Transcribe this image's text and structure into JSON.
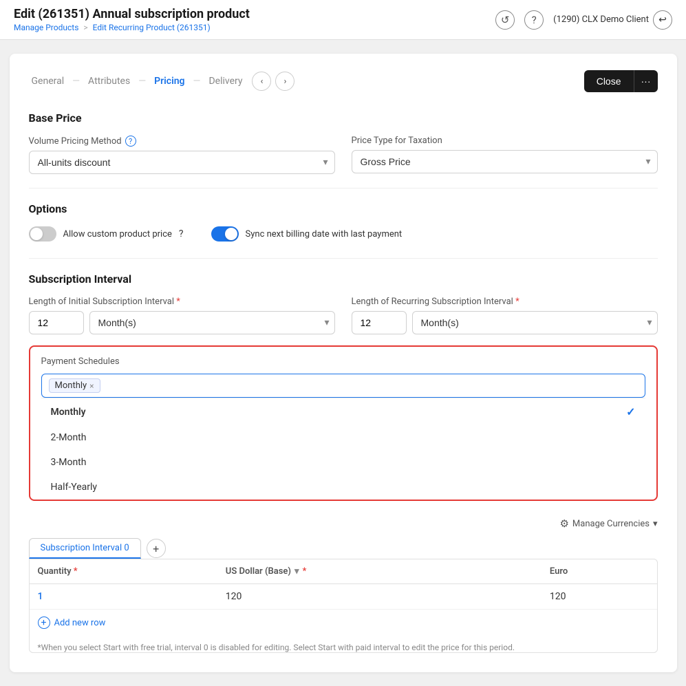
{
  "page": {
    "title": "Edit (261351) Annual subscription product",
    "breadcrumb_root": "Manage Products",
    "breadcrumb_sep": ">",
    "breadcrumb_current": "Edit Recurring Product (261351)"
  },
  "topbar": {
    "history_icon": "↺",
    "help_icon": "?",
    "client_label": "(1290) CLX Demo Client",
    "client_icon": "↩"
  },
  "nav": {
    "tabs": [
      {
        "label": "General",
        "active": false
      },
      {
        "label": "Attributes",
        "active": false
      },
      {
        "label": "Pricing",
        "active": true
      },
      {
        "label": "Delivery",
        "active": false
      }
    ],
    "close_label": "Close",
    "more_label": "···"
  },
  "base_price": {
    "section_title": "Base Price",
    "volume_label": "Volume Pricing Method",
    "volume_help": "?",
    "volume_value": "All-units discount",
    "price_type_label": "Price Type for Taxation",
    "price_type_value": "Gross Price"
  },
  "options": {
    "section_title": "Options",
    "allow_custom_label": "Allow custom product price",
    "allow_custom_toggle": "off",
    "sync_label": "Sync next billing date with last payment",
    "sync_toggle": "on"
  },
  "subscription_interval": {
    "section_title": "Subscription Interval",
    "initial_label": "Length of Initial Subscription Interval",
    "initial_value": "12",
    "initial_unit": "Month(s)",
    "recurring_label": "Length of Recurring Subscription Interval",
    "recurring_value": "12",
    "recurring_unit": "Month(s)"
  },
  "payment_schedules": {
    "label": "Payment Schedules",
    "selected_tag": "Monthly",
    "input_placeholder": "",
    "dropdown_items": [
      {
        "label": "Monthly",
        "selected": true
      },
      {
        "label": "2-Month",
        "selected": false
      },
      {
        "label": "3-Month",
        "selected": false
      },
      {
        "label": "Half-Yearly",
        "selected": false
      }
    ]
  },
  "manage_currencies": {
    "label": "Manage Currencies",
    "icon": "⚙"
  },
  "price_table": {
    "tab_label": "Subscription Interval 0",
    "add_tab_icon": "+",
    "columns": [
      {
        "label": "Quantity",
        "required": true
      },
      {
        "label": "US Dollar (Base)",
        "has_chevron": true,
        "required": true
      },
      {
        "label": "Euro",
        "has_chevron": false
      }
    ],
    "rows": [
      {
        "quantity": "1",
        "usd": "120",
        "euro": "120"
      }
    ],
    "add_row_label": "Add new row",
    "footnote": "*When you select Start with free trial, interval 0 is disabled for editing. Select Start with paid interval to edit the price for this period."
  }
}
